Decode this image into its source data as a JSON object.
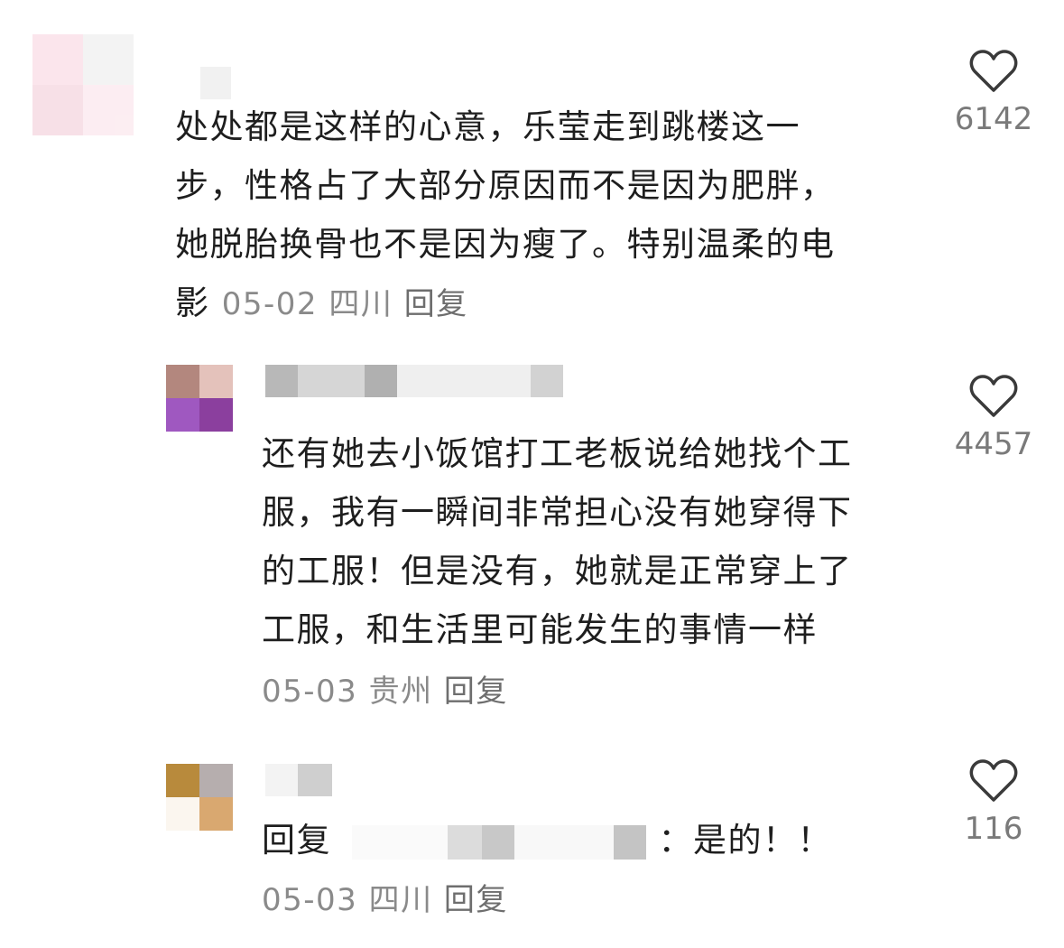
{
  "comments": [
    {
      "text_lines": [
        "处处都是这样的心意，乐莹走到跳楼这一",
        "步，性格占了大部分原因而不是因为肥胖，",
        "她脱胎换骨也不是因为瘦了。特别温柔的电"
      ],
      "last_line": "影",
      "date": "05-02",
      "location": "四川",
      "reply_label": "回复",
      "likes": "6142",
      "avatar_colors": [
        "#fbe3ea",
        "#f7dde5",
        "#fdf0f4",
        "#f8e6ec"
      ]
    },
    {
      "text_lines": [
        "还有她去小饭馆打工老板说给她找个工",
        "服，我有一瞬间非常担心没有她穿得下",
        "的工服！但是没有，她就是正常穿上了",
        "工服，和生活里可能发生的事情一样"
      ],
      "date": "05-03",
      "location": "贵州",
      "reply_label": "回复",
      "likes": "4457",
      "avatar_colors": [
        "#b3877e",
        "#e4c2bb",
        "#9f58c0",
        "#8b3f9e"
      ]
    },
    {
      "reply_prefix": "回复",
      "reply_text": "：是的！！",
      "date": "05-03",
      "location": "四川",
      "reply_label": "回复",
      "likes": "116",
      "avatar_colors": [
        "#b88a3c",
        "#b6aeae",
        "#fbf6ef",
        "#d9a870"
      ]
    }
  ]
}
